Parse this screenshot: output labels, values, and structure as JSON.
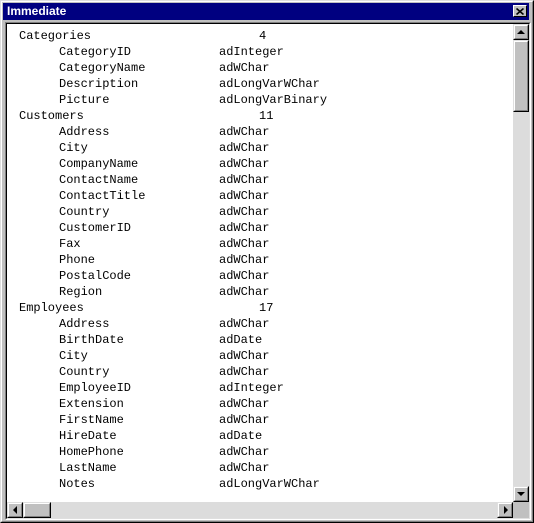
{
  "window": {
    "title": "Immediate",
    "close_glyph": "✕"
  },
  "lines": [
    {
      "kind": "table",
      "name": "Categories",
      "count": "4"
    },
    {
      "kind": "field",
      "name": "CategoryID",
      "type": "adInteger"
    },
    {
      "kind": "field",
      "name": "CategoryName",
      "type": "adWChar"
    },
    {
      "kind": "field",
      "name": "Description",
      "type": "adLongVarWChar"
    },
    {
      "kind": "field",
      "name": "Picture",
      "type": "adLongVarBinary"
    },
    {
      "kind": "table",
      "name": "Customers",
      "count": "11"
    },
    {
      "kind": "field",
      "name": "Address",
      "type": "adWChar"
    },
    {
      "kind": "field",
      "name": "City",
      "type": "adWChar"
    },
    {
      "kind": "field",
      "name": "CompanyName",
      "type": "adWChar"
    },
    {
      "kind": "field",
      "name": "ContactName",
      "type": "adWChar"
    },
    {
      "kind": "field",
      "name": "ContactTitle",
      "type": "adWChar"
    },
    {
      "kind": "field",
      "name": "Country",
      "type": "adWChar"
    },
    {
      "kind": "field",
      "name": "CustomerID",
      "type": "adWChar"
    },
    {
      "kind": "field",
      "name": "Fax",
      "type": "adWChar"
    },
    {
      "kind": "field",
      "name": "Phone",
      "type": "adWChar"
    },
    {
      "kind": "field",
      "name": "PostalCode",
      "type": "adWChar"
    },
    {
      "kind": "field",
      "name": "Region",
      "type": "adWChar"
    },
    {
      "kind": "table",
      "name": "Employees",
      "count": "17"
    },
    {
      "kind": "field",
      "name": "Address",
      "type": "adWChar"
    },
    {
      "kind": "field",
      "name": "BirthDate",
      "type": "adDate"
    },
    {
      "kind": "field",
      "name": "City",
      "type": "adWChar"
    },
    {
      "kind": "field",
      "name": "Country",
      "type": "adWChar"
    },
    {
      "kind": "field",
      "name": "EmployeeID",
      "type": "adInteger"
    },
    {
      "kind": "field",
      "name": "Extension",
      "type": "adWChar"
    },
    {
      "kind": "field",
      "name": "FirstName",
      "type": "adWChar"
    },
    {
      "kind": "field",
      "name": "HireDate",
      "type": "adDate"
    },
    {
      "kind": "field",
      "name": "HomePhone",
      "type": "adWChar"
    },
    {
      "kind": "field",
      "name": "LastName",
      "type": "adWChar"
    },
    {
      "kind": "field",
      "name": "Notes",
      "type": "adLongVarWChar"
    }
  ],
  "colors": {
    "titlebar": "#000080",
    "title_text": "#ffffff",
    "chrome": "#c0c0c0",
    "scroll_track": "#dcdcdc",
    "text": "#000000"
  },
  "icons": {
    "close": "close-icon",
    "scroll_up": "arrow-up-icon",
    "scroll_down": "arrow-down-icon",
    "scroll_left": "arrow-left-icon",
    "scroll_right": "arrow-right-icon"
  }
}
